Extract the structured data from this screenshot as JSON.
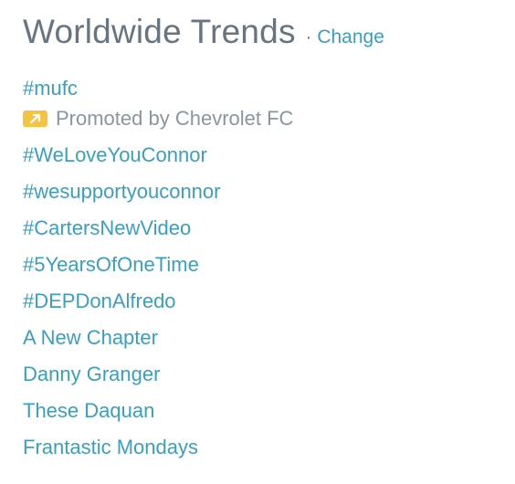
{
  "header": {
    "title": "Worldwide Trends",
    "separator": "·",
    "change_label": "Change"
  },
  "promoted_trend": {
    "name": "#mufc",
    "promoted_text": "Promoted by Chevrolet FC",
    "badge_icon": "promoted-arrow-icon",
    "badge_color": "#f5c242"
  },
  "trends": [
    "#WeLoveYouConnor",
    "#wesupportyouconnor",
    "#CartersNewVideo",
    "#5YearsOfOneTime",
    "#DEPDonAlfredo",
    "A New Chapter",
    "Danny Granger",
    "These Daquan",
    "Frantastic Mondays"
  ],
  "colors": {
    "link": "#3a9fbf",
    "title": "#66757f",
    "muted": "#8a959d"
  }
}
